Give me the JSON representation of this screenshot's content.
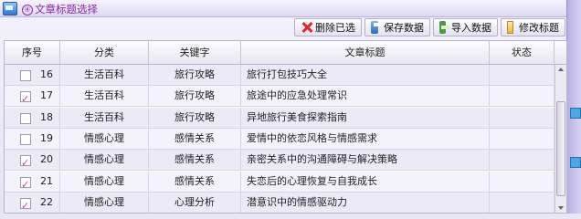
{
  "window": {
    "title_prefix": "④",
    "title": "文章标题选择"
  },
  "toolbar": {
    "delete_label": "删除已选",
    "save_label": "保存数据",
    "import_label": "导入数据",
    "edit_label": "修改标题"
  },
  "table": {
    "columns": [
      "序号",
      "分类",
      "关键字",
      "文章标题",
      "状态"
    ],
    "rows": [
      {
        "index": "16",
        "checked": false,
        "category": "生活百科",
        "keyword": "旅行攻略",
        "title": "旅行打包技巧大全",
        "status": ""
      },
      {
        "index": "17",
        "checked": true,
        "category": "生活百科",
        "keyword": "旅行攻略",
        "title": "旅途中的应急处理常识",
        "status": ""
      },
      {
        "index": "18",
        "checked": false,
        "category": "生活百科",
        "keyword": "旅行攻略",
        "title": "异地旅行美食探索指南",
        "status": ""
      },
      {
        "index": "19",
        "checked": false,
        "category": "情感心理",
        "keyword": "感情关系",
        "title": "爱情中的依恋风格与情感需求",
        "status": ""
      },
      {
        "index": "20",
        "checked": true,
        "category": "情感心理",
        "keyword": "感情关系",
        "title": "亲密关系中的沟通障碍与解决策略",
        "status": ""
      },
      {
        "index": "21",
        "checked": true,
        "category": "情感心理",
        "keyword": "感情关系",
        "title": "失恋后的心理恢复与自我成长",
        "status": ""
      },
      {
        "index": "22",
        "checked": true,
        "category": "情感心理",
        "keyword": "心理分析",
        "title": "潜意识中的情感驱动力",
        "status": ""
      }
    ]
  },
  "colors": {
    "title_accent": "#8b2aa8",
    "check_mark": "#c4449c",
    "delete_icon": "#e0262b"
  }
}
